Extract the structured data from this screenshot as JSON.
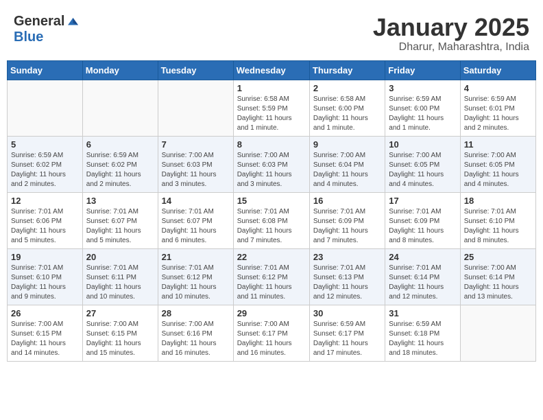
{
  "header": {
    "logo_general": "General",
    "logo_blue": "Blue",
    "calendar_title": "January 2025",
    "calendar_subtitle": "Dharur, Maharashtra, India"
  },
  "weekdays": [
    "Sunday",
    "Monday",
    "Tuesday",
    "Wednesday",
    "Thursday",
    "Friday",
    "Saturday"
  ],
  "weeks": [
    [
      {
        "day": "",
        "info": ""
      },
      {
        "day": "",
        "info": ""
      },
      {
        "day": "",
        "info": ""
      },
      {
        "day": "1",
        "info": "Sunrise: 6:58 AM\nSunset: 5:59 PM\nDaylight: 11 hours\nand 1 minute."
      },
      {
        "day": "2",
        "info": "Sunrise: 6:58 AM\nSunset: 6:00 PM\nDaylight: 11 hours\nand 1 minute."
      },
      {
        "day": "3",
        "info": "Sunrise: 6:59 AM\nSunset: 6:00 PM\nDaylight: 11 hours\nand 1 minute."
      },
      {
        "day": "4",
        "info": "Sunrise: 6:59 AM\nSunset: 6:01 PM\nDaylight: 11 hours\nand 2 minutes."
      }
    ],
    [
      {
        "day": "5",
        "info": "Sunrise: 6:59 AM\nSunset: 6:02 PM\nDaylight: 11 hours\nand 2 minutes."
      },
      {
        "day": "6",
        "info": "Sunrise: 6:59 AM\nSunset: 6:02 PM\nDaylight: 11 hours\nand 2 minutes."
      },
      {
        "day": "7",
        "info": "Sunrise: 7:00 AM\nSunset: 6:03 PM\nDaylight: 11 hours\nand 3 minutes."
      },
      {
        "day": "8",
        "info": "Sunrise: 7:00 AM\nSunset: 6:03 PM\nDaylight: 11 hours\nand 3 minutes."
      },
      {
        "day": "9",
        "info": "Sunrise: 7:00 AM\nSunset: 6:04 PM\nDaylight: 11 hours\nand 4 minutes."
      },
      {
        "day": "10",
        "info": "Sunrise: 7:00 AM\nSunset: 6:05 PM\nDaylight: 11 hours\nand 4 minutes."
      },
      {
        "day": "11",
        "info": "Sunrise: 7:00 AM\nSunset: 6:05 PM\nDaylight: 11 hours\nand 4 minutes."
      }
    ],
    [
      {
        "day": "12",
        "info": "Sunrise: 7:01 AM\nSunset: 6:06 PM\nDaylight: 11 hours\nand 5 minutes."
      },
      {
        "day": "13",
        "info": "Sunrise: 7:01 AM\nSunset: 6:07 PM\nDaylight: 11 hours\nand 5 minutes."
      },
      {
        "day": "14",
        "info": "Sunrise: 7:01 AM\nSunset: 6:07 PM\nDaylight: 11 hours\nand 6 minutes."
      },
      {
        "day": "15",
        "info": "Sunrise: 7:01 AM\nSunset: 6:08 PM\nDaylight: 11 hours\nand 7 minutes."
      },
      {
        "day": "16",
        "info": "Sunrise: 7:01 AM\nSunset: 6:09 PM\nDaylight: 11 hours\nand 7 minutes."
      },
      {
        "day": "17",
        "info": "Sunrise: 7:01 AM\nSunset: 6:09 PM\nDaylight: 11 hours\nand 8 minutes."
      },
      {
        "day": "18",
        "info": "Sunrise: 7:01 AM\nSunset: 6:10 PM\nDaylight: 11 hours\nand 8 minutes."
      }
    ],
    [
      {
        "day": "19",
        "info": "Sunrise: 7:01 AM\nSunset: 6:10 PM\nDaylight: 11 hours\nand 9 minutes."
      },
      {
        "day": "20",
        "info": "Sunrise: 7:01 AM\nSunset: 6:11 PM\nDaylight: 11 hours\nand 10 minutes."
      },
      {
        "day": "21",
        "info": "Sunrise: 7:01 AM\nSunset: 6:12 PM\nDaylight: 11 hours\nand 10 minutes."
      },
      {
        "day": "22",
        "info": "Sunrise: 7:01 AM\nSunset: 6:12 PM\nDaylight: 11 hours\nand 11 minutes."
      },
      {
        "day": "23",
        "info": "Sunrise: 7:01 AM\nSunset: 6:13 PM\nDaylight: 11 hours\nand 12 minutes."
      },
      {
        "day": "24",
        "info": "Sunrise: 7:01 AM\nSunset: 6:14 PM\nDaylight: 11 hours\nand 12 minutes."
      },
      {
        "day": "25",
        "info": "Sunrise: 7:00 AM\nSunset: 6:14 PM\nDaylight: 11 hours\nand 13 minutes."
      }
    ],
    [
      {
        "day": "26",
        "info": "Sunrise: 7:00 AM\nSunset: 6:15 PM\nDaylight: 11 hours\nand 14 minutes."
      },
      {
        "day": "27",
        "info": "Sunrise: 7:00 AM\nSunset: 6:15 PM\nDaylight: 11 hours\nand 15 minutes."
      },
      {
        "day": "28",
        "info": "Sunrise: 7:00 AM\nSunset: 6:16 PM\nDaylight: 11 hours\nand 16 minutes."
      },
      {
        "day": "29",
        "info": "Sunrise: 7:00 AM\nSunset: 6:17 PM\nDaylight: 11 hours\nand 16 minutes."
      },
      {
        "day": "30",
        "info": "Sunrise: 6:59 AM\nSunset: 6:17 PM\nDaylight: 11 hours\nand 17 minutes."
      },
      {
        "day": "31",
        "info": "Sunrise: 6:59 AM\nSunset: 6:18 PM\nDaylight: 11 hours\nand 18 minutes."
      },
      {
        "day": "",
        "info": ""
      }
    ]
  ]
}
